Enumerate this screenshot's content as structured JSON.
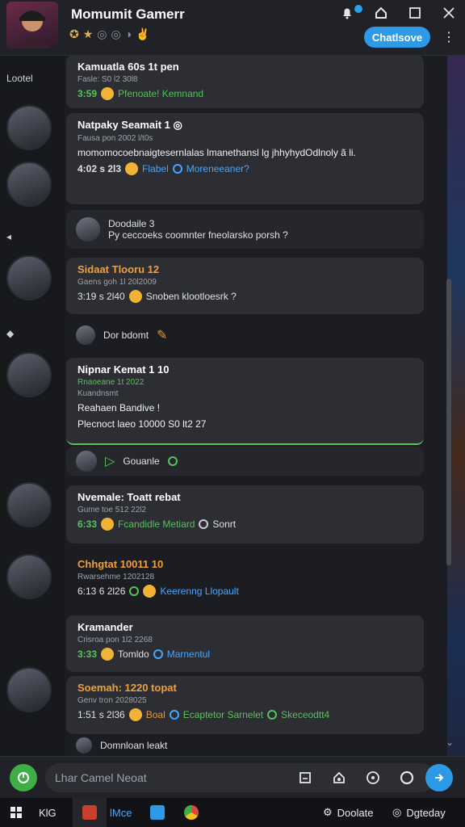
{
  "header": {
    "title": "Momumit Gamerr",
    "badges": [
      "✪",
      "★",
      "◎",
      "◎",
      "◑",
      "✌"
    ],
    "cta_label": "Chatlsove",
    "kebab": "⋮"
  },
  "side_label": "Lootel",
  "messages": [
    {
      "name": "Kamuatla 60s 1t pen",
      "meta": "Fasle: S0 l2 30l8",
      "num": "3:59",
      "text": "Pfenoate! Kemnand",
      "text_color": "green"
    },
    {
      "name": "Natpaky Seamait 1 ◎",
      "meta": "Fausa pon 2002 l/t0s",
      "body": "momomocoebnaigtesernlalas lmanethansl lg jhhyhydOdlnoly ã li.",
      "num": "4:02 s 2l3",
      "link1": "Flabel",
      "link2": "Moreneeaner?"
    },
    {
      "reply_name": "Doodaile 3",
      "reply_text": "Py ceccoeks coomnter fneolarsko porsh ?"
    },
    {
      "name": "Sidaat Tlooru 12",
      "meta": "Gaens goh 1l 20l2009",
      "num": "3:19 s 2l40",
      "text": "Snoben klootloesrk ?"
    },
    {
      "reply_text": "Dor bdomt"
    },
    {
      "name": "Nipnar Kemat 1 10",
      "meta": "Rnaoeane 1t 2022",
      "meta2": "Kuandnsmt",
      "body": "Reahaen Bandive !",
      "body2": "Plecnoct laeo 10000 S0 lt2 27"
    },
    {
      "reply_text": "Gouanle"
    },
    {
      "name": "Nvemale: Toatt rebat",
      "meta": "Gume toe 512 22l2",
      "num": "6:33",
      "text": "Fcandidle Metiard",
      "text2": "Sonrt"
    },
    {
      "name": "Chhgtat 10011 10",
      "meta": "Rwarsehme 1202128",
      "num": "6:13 6 2l26",
      "text": "Keerenng Llopault"
    },
    {
      "name": "Kramander",
      "meta": "Crisroa pon 1l2 2268",
      "num": "3:33",
      "text": "Tomldo",
      "text2": "Marnentul"
    },
    {
      "name": "Soemah: 1220 topat",
      "meta": "Genv tron 2028025",
      "num": "1:51 s 2l36",
      "text": "Boal",
      "text2": "Ecaptetor Sarnelet",
      "text3": "Skeceodtt4"
    },
    {
      "reply_text": "Domnloan leakt"
    }
  ],
  "composer": {
    "placeholder": "Lhar Camel Neoat"
  },
  "taskbar": {
    "item1": "KlG",
    "item2": "lMce",
    "item3": "Doolate",
    "item4": "Dgteday"
  }
}
